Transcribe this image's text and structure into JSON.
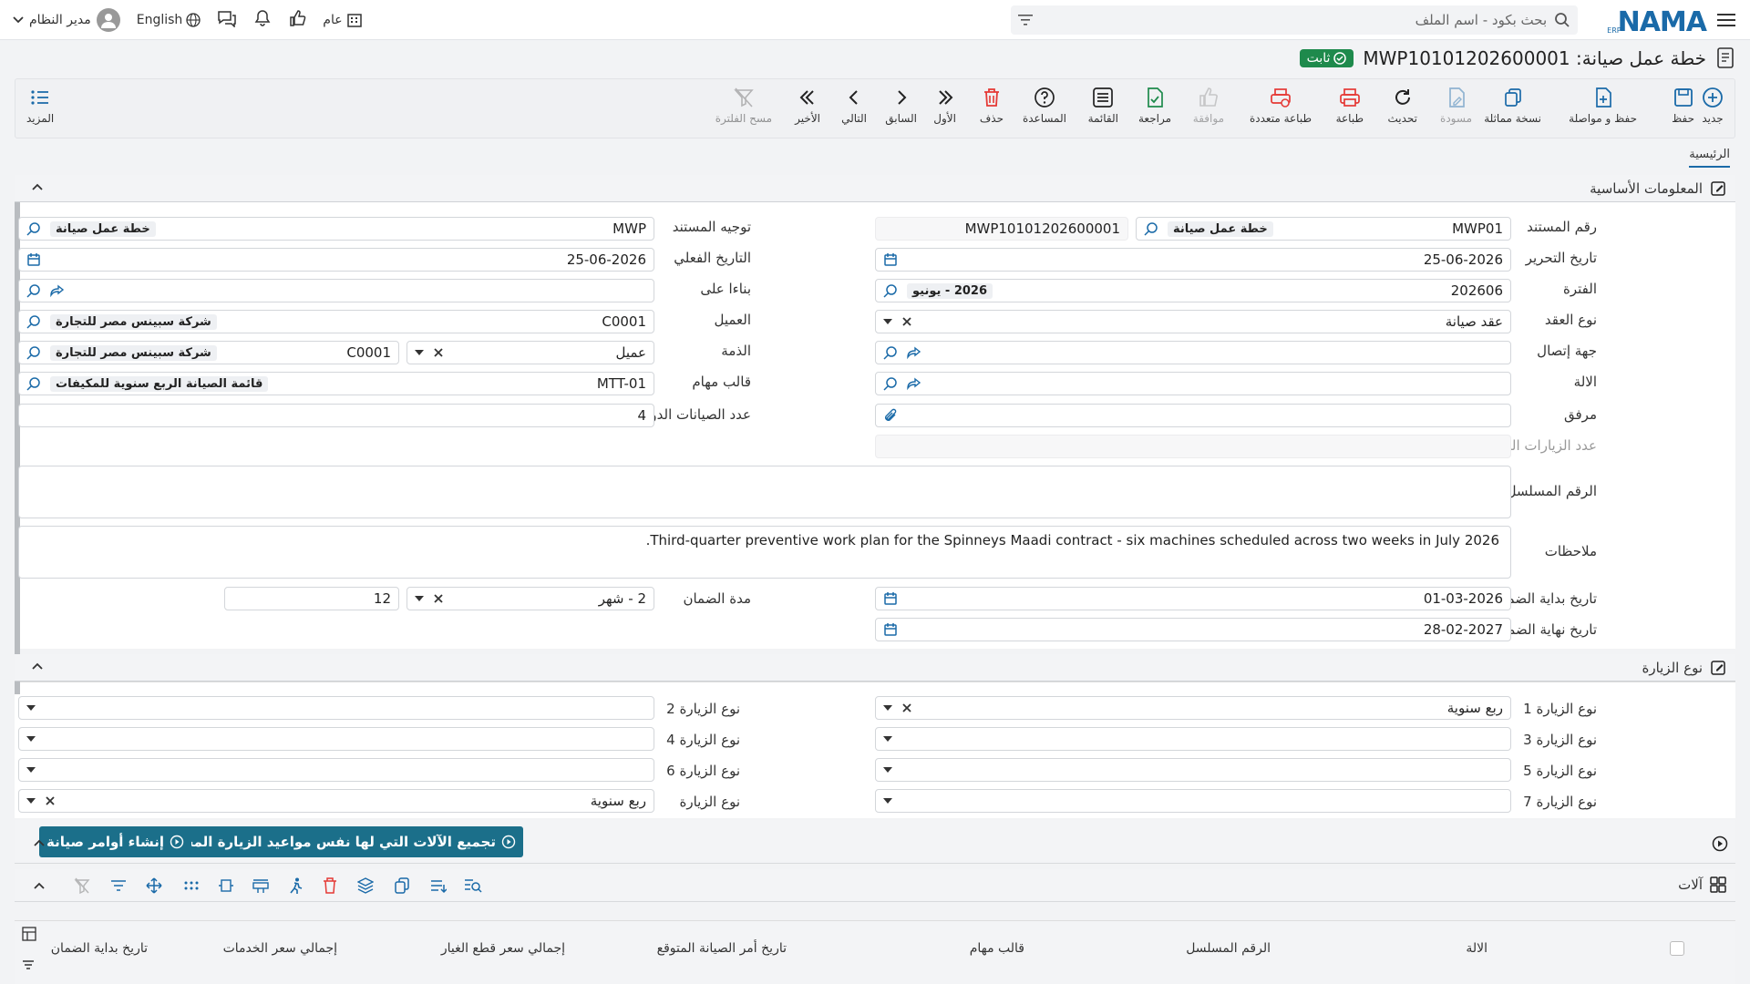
{
  "topbar": {
    "logo": "NAMA",
    "logo_sub": "ERP",
    "search_placeholder": "بحث بكود - اسم الملف",
    "public_label": "عام",
    "language_label": "English",
    "user_name": "مدير النظام"
  },
  "header": {
    "title": "خطة عمل صيانة: MWP10101202600001",
    "status": "ثابت"
  },
  "toolbar": {
    "new": "جديد",
    "save": "حفظ",
    "save_continue": "حفظ و مواصلة",
    "copy": "نسخة مماثلة",
    "draft": "مسودة",
    "refresh": "تحديث",
    "print": "طباعة",
    "multi_print": "طباعة متعددة",
    "approve": "موافقة",
    "review": "مراجعة",
    "list": "القائمة",
    "help": "المساعدة",
    "delete": "حذف",
    "first": "الأول",
    "previous": "السابق",
    "next": "التالي",
    "last": "الأخير",
    "clear_filter": "مسح الفلترة",
    "more": "المزيد"
  },
  "tabs": {
    "main": "الرئيسية"
  },
  "basic": {
    "title": "المعلومات الأساسية",
    "doc_no_label": "رقم المستند",
    "doc_no_code": "MWP01",
    "doc_no_name": "خطة عمل صيانة",
    "doc_no_value": "MWP10101202600001",
    "edit_date_label": "تاريخ التحرير",
    "edit_date": "25-06-2026",
    "period_label": "الفترة",
    "period_code": "202606",
    "period_name": "2026 - يونيو",
    "contract_type_label": "نوع العقد",
    "contract_type": "عقد صيانة",
    "contact_label": "جهة إتصال",
    "machine_label": "الالة",
    "attachment_label": "مرفق",
    "executed_visits_label": "عدد الزيارات المنفذة",
    "doc_direction_label": "توجيه المستند",
    "doc_direction_code": "MWP",
    "doc_direction_name": "خطة عمل صيانة",
    "actual_date_label": "التاريخ الفعلي",
    "actual_date": "25-06-2026",
    "based_on_label": "بناءا على",
    "customer_label": "العميل",
    "customer_code": "C0001",
    "customer_name": "شركة سبينس مصر للتجارة",
    "account_label": "الذمة",
    "account_type": "عميل",
    "account_code": "C0001",
    "account_name": "شركة سبينس مصر للتجارة",
    "task_template_label": "قالب مهام",
    "task_template_code": "MTT-01",
    "task_template_name": "قائمة الصيانة الربع سنوية للمكيفات",
    "periodic_count_label": "عدد الصيانات الدورية",
    "periodic_count": "4",
    "serial_label": "الرقم المسلسل",
    "notes_label": "ملاحظات",
    "notes": "Third-quarter preventive work plan for the Spinneys Maadi contract - six machines scheduled across two weeks in July 2026.",
    "warranty_start_label": "تاريخ بداية الضمان",
    "warranty_start": "01-03-2026",
    "warranty_end_label": "تاريخ نهاية الضمان",
    "warranty_end": "28-02-2027",
    "warranty_period_label": "مدة الضمان",
    "warranty_unit": "2 - شهر",
    "warranty_period": "12"
  },
  "visit": {
    "title": "نوع الزيارة",
    "v1_label": "نوع الزيارة 1",
    "v1": "ربع سنوية",
    "v2_label": "نوع الزيارة 2",
    "v3_label": "نوع الزيارة 3",
    "v4_label": "نوع الزيارة 4",
    "v5_label": "نوع الزيارة 5",
    "v6_label": "نوع الزيارة 6",
    "v7_label": "نوع الزيارة 7",
    "visit_type_label": "نوع الزيارة",
    "visit_type": "ربع سنوية"
  },
  "actions": {
    "group_machines": "تجميع الآلات التي لها نفس مواعيد الزيارة المحددة",
    "create_orders": "إنشاء أوامر صيانة"
  },
  "machines": {
    "title": "آلات",
    "columns": [
      "الالة",
      "الرقم المسلسل",
      "قالب مهام",
      "تاريخ أمر الصيانة المتوقع",
      "إجمالي سعر قطع الغيار",
      "إجمالي سعر الخدمات",
      "تاريخ بداية الضمان"
    ]
  },
  "colors": {
    "accent": "#1a6aa8",
    "status_green": "#1e8a4c",
    "action_button": "#1b6f8a",
    "danger": "#e53935"
  }
}
